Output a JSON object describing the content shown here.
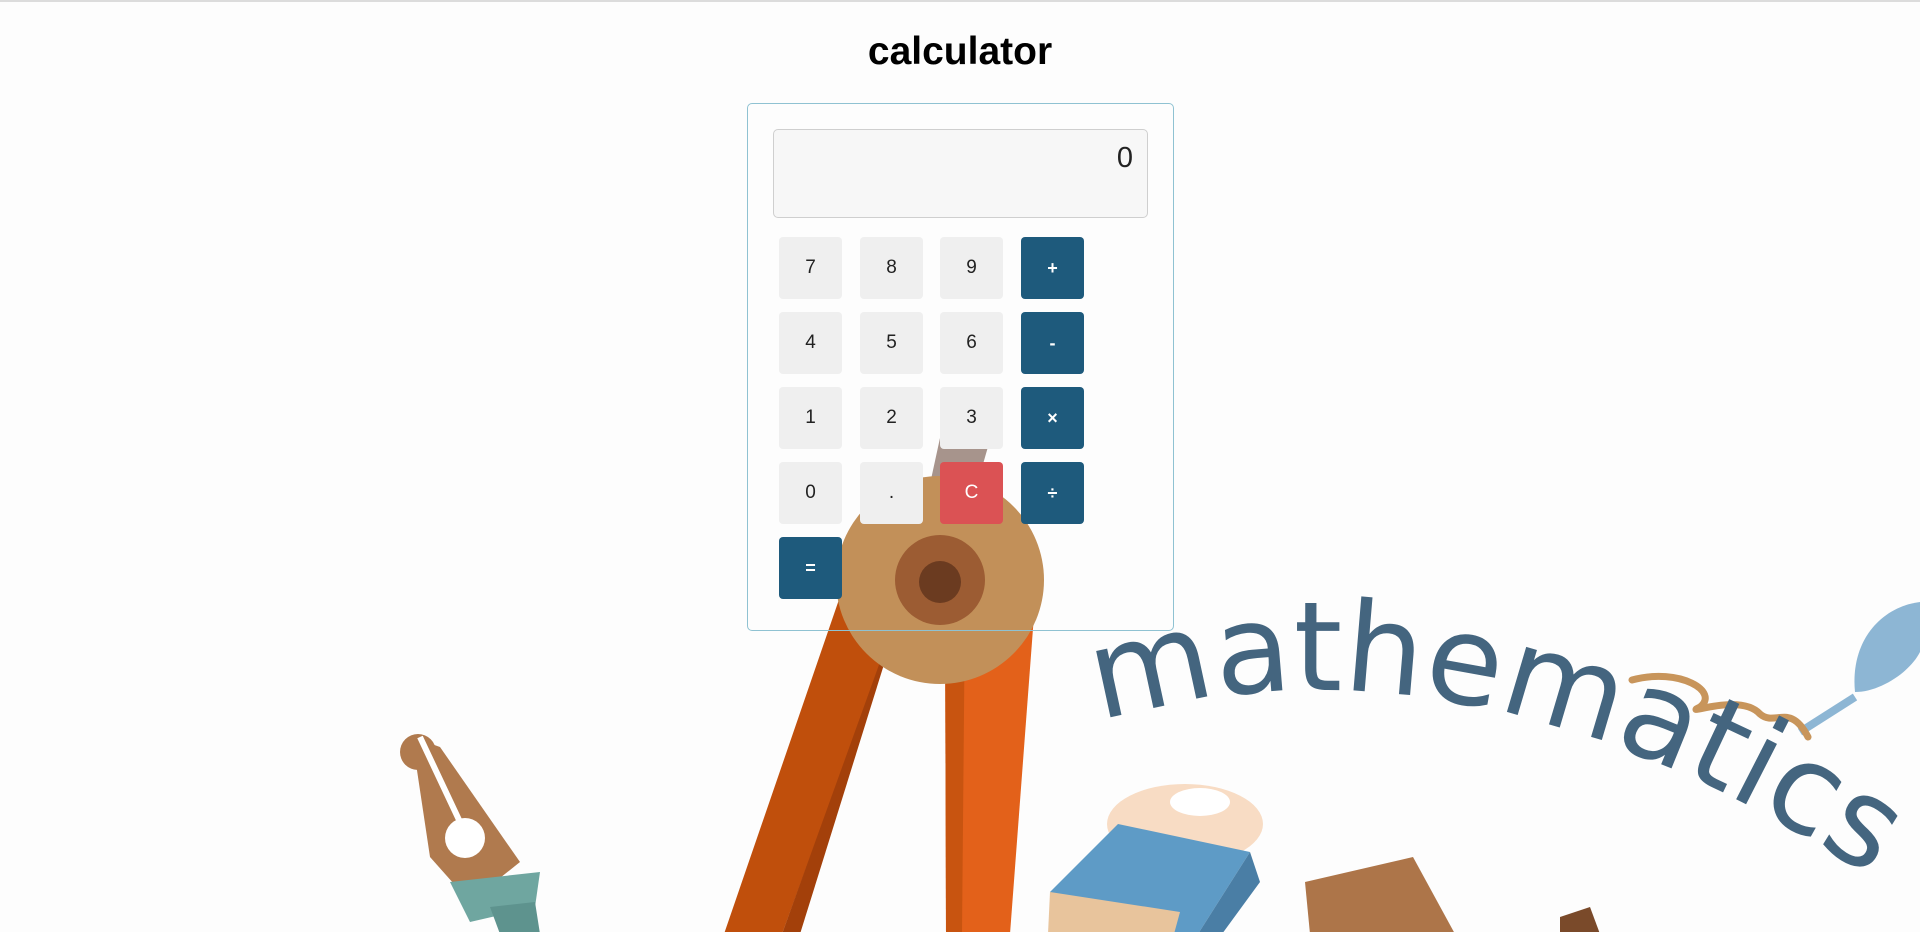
{
  "page": {
    "title": "calculator"
  },
  "calculator": {
    "display_value": "0",
    "buttons": {
      "b7": "7",
      "b8": "8",
      "b9": "9",
      "add": "+",
      "b4": "4",
      "b5": "5",
      "b6": "6",
      "subtract": "-",
      "b1": "1",
      "b2": "2",
      "b3": "3",
      "multiply": "×",
      "b0": "0",
      "decimal": ".",
      "clear": "C",
      "divide": "÷",
      "equals": "="
    }
  },
  "background": {
    "word": "mathematics"
  },
  "colors": {
    "operator": "#1e5a7c",
    "clear": "#db5254",
    "number": "#efefef",
    "border": "#8fc2d2"
  }
}
